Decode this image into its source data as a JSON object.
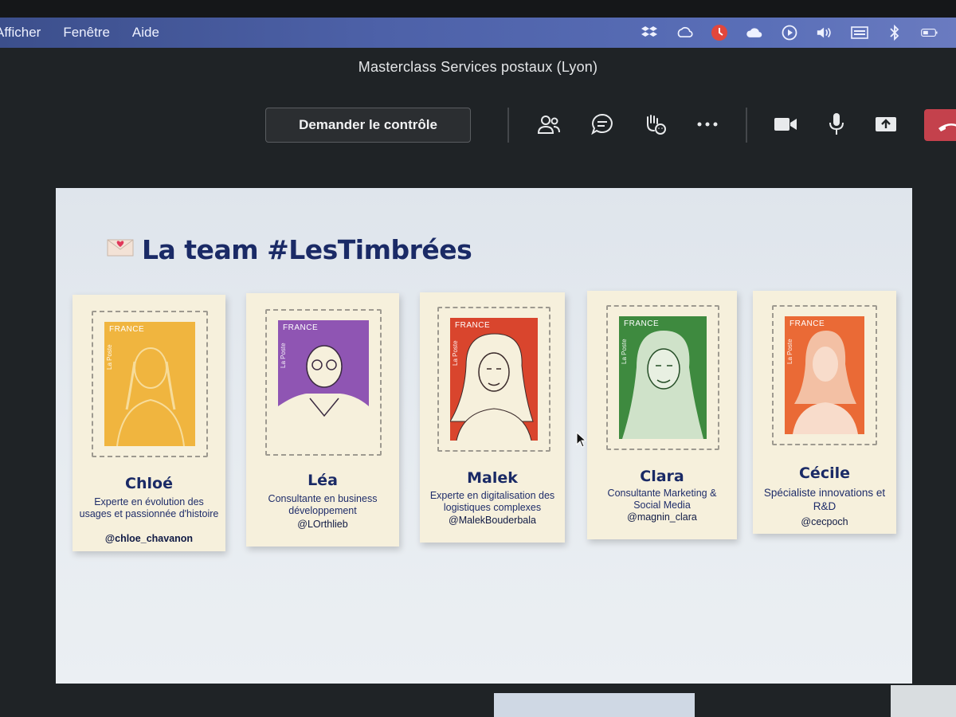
{
  "menubar": {
    "items": [
      "Afficher",
      "Fenêtre",
      "Aide"
    ],
    "tray_icons": [
      "dropbox-icon",
      "creative-cloud-icon",
      "clock-icon",
      "cloud-icon",
      "play-icon",
      "volume-icon",
      "keyboard-icon",
      "bluetooth-icon",
      "battery-icon"
    ]
  },
  "meeting": {
    "title": "Masterclass Services postaux (Lyon)",
    "request_control": "Demander le contrôle"
  },
  "slide": {
    "title": "La team #LesTimbrées",
    "cards": [
      {
        "name": "Chloé",
        "desc": "Experte en évolution des usages et passionnée d'histoire",
        "handle": "@chloe_chavanon",
        "country": "FRANCE",
        "poste": "La Poste",
        "color": "#f0b53f"
      },
      {
        "name": "Léa",
        "desc": "Consultante en business développement",
        "handle": "@LOrthlieb",
        "country": "FRANCE",
        "poste": "La Poste",
        "color": "#8f55b3"
      },
      {
        "name": "Malek",
        "desc": "Experte en digitalisation des logistiques complexes",
        "handle": "@MalekBouderbala",
        "country": "FRANCE",
        "poste": "La Poste",
        "color": "#d9452d"
      },
      {
        "name": "Clara",
        "desc": "Consultante Marketing & Social Media",
        "handle": "@magnin_clara",
        "country": "FRANCE",
        "poste": "La Poste",
        "color": "#3e8a3f"
      },
      {
        "name": "Cécile",
        "desc": "Spécialiste innovations et R&D",
        "handle": "@cecpoch",
        "country": "FRANCE",
        "poste": "La Poste",
        "color": "#ea6a36"
      }
    ]
  }
}
